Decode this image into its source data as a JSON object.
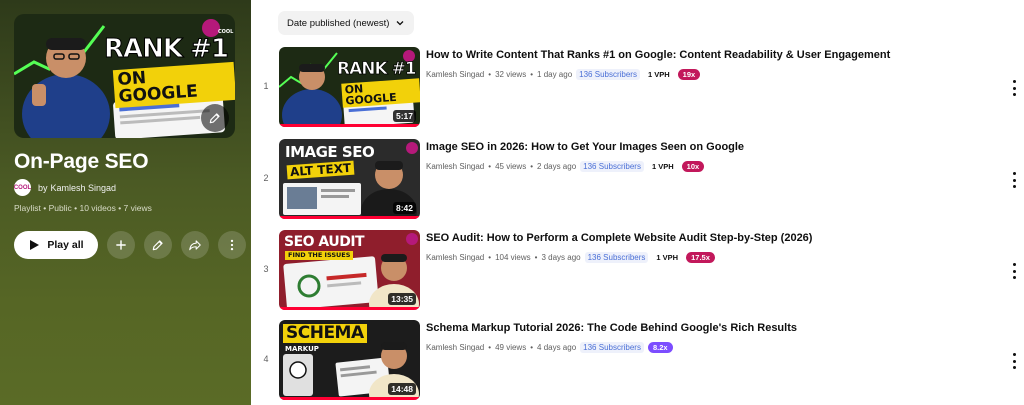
{
  "playlist": {
    "thumb": {
      "headline_top": "RANK #1",
      "headline_bottom": "ON GOOGLE",
      "brand": "COOL"
    },
    "title": "On-Page SEO",
    "owner_prefix": "by",
    "owner": "Kamlesh Singad",
    "owner_avatar_text": "COOL",
    "meta": "Playlist • Public • 10 videos • 7 views",
    "actions": {
      "play_all": "Play all",
      "add_icon": "plus-icon",
      "edit_icon": "pencil-icon",
      "share_icon": "share-icon",
      "more_icon": "more-vert-icon"
    },
    "edit_thumb_icon": "pencil-icon"
  },
  "sort": {
    "label": "Date published (newest)",
    "icon": "chevron-down-icon"
  },
  "colors": {
    "panel": "#4b5a24",
    "progress": "#ff0033",
    "subs_text": "#4a6fd6",
    "mult_red": "#c2185b",
    "mult_purple": "#7c4dff"
  },
  "videos": [
    {
      "index": "1",
      "title": "How to Write Content That Ranks #1 on Google: Content Readability & User Engagement",
      "channel": "Kamlesh Singad",
      "views": "32 views",
      "age": "1 day ago",
      "subs": "136 Subscribers",
      "vph": "1 VPH",
      "mult": "19x",
      "mult_color": "#c2185b",
      "duration": "5:17",
      "progress": 1.0,
      "thumb_lines": [
        "RANK #1",
        "ON GOOGLE"
      ]
    },
    {
      "index": "2",
      "title": "Image SEO in 2026: How to Get Your Images Seen on Google",
      "channel": "Kamlesh Singad",
      "views": "45 views",
      "age": "2 days ago",
      "subs": "136 Subscribers",
      "vph": "1 VPH",
      "mult": "10x",
      "mult_color": "#c2185b",
      "duration": "8:42",
      "progress": 1.0,
      "thumb_lines": [
        "IMAGE SEO",
        "ALT TEXT"
      ]
    },
    {
      "index": "3",
      "title": "SEO Audit: How to Perform a Complete Website Audit Step-by-Step (2026)",
      "channel": "Kamlesh Singad",
      "views": "104 views",
      "age": "3 days ago",
      "subs": "136 Subscribers",
      "vph": "1 VPH",
      "mult": "17.5x",
      "mult_color": "#c2185b",
      "duration": "13:35",
      "progress": 1.0,
      "thumb_lines": [
        "SEO AUDIT",
        "FIND THE ISSUES"
      ]
    },
    {
      "index": "4",
      "title": "Schema Markup Tutorial 2026: The Code Behind Google's Rich Results",
      "channel": "Kamlesh Singad",
      "views": "49 views",
      "age": "4 days ago",
      "subs": "136 Subscribers",
      "vph": "",
      "mult": "8.2x",
      "mult_color": "#7c4dff",
      "duration": "14:48",
      "progress": 1.0,
      "thumb_lines": [
        "SCHEMA",
        "MARKUP"
      ]
    }
  ]
}
